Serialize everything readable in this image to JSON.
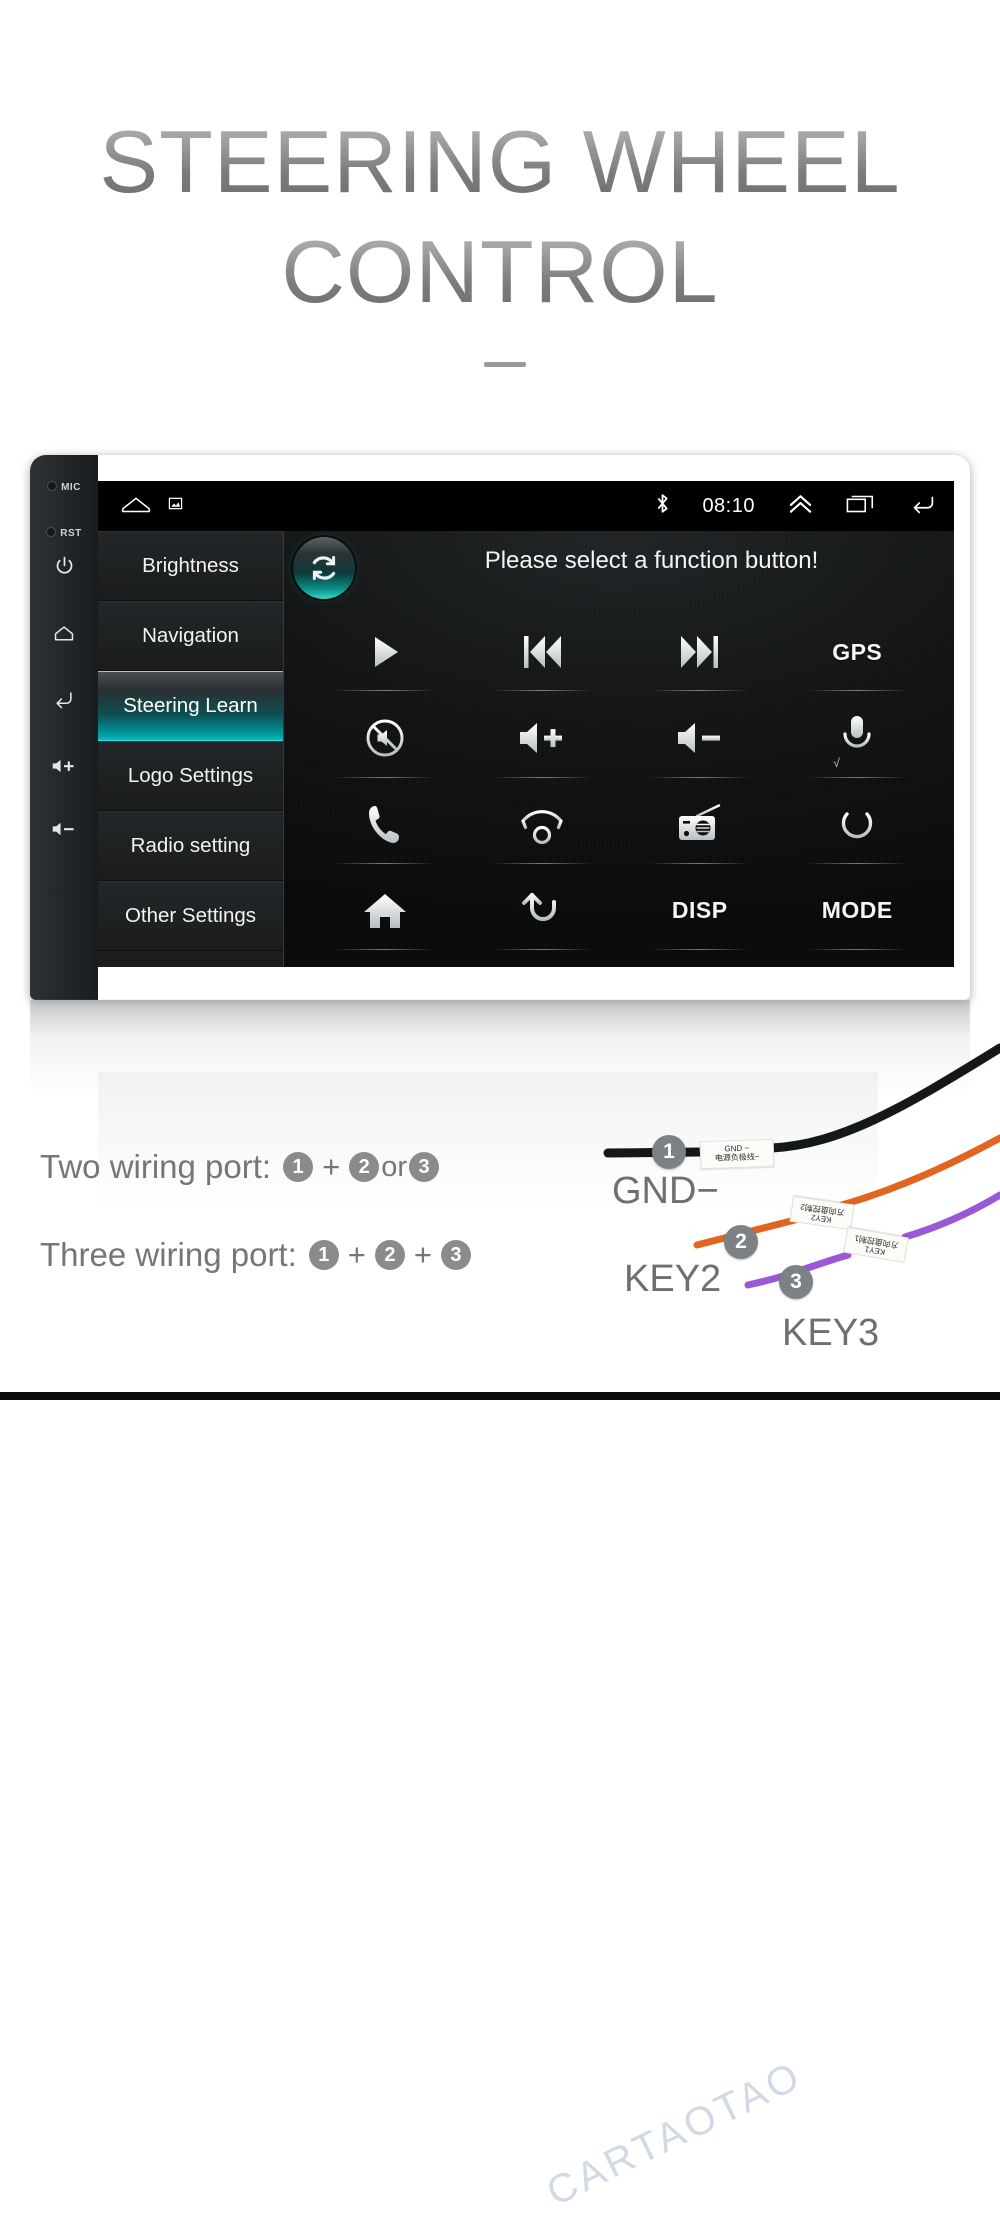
{
  "hero": {
    "line1": "STEERING WHEEL",
    "line2": "CONTROL"
  },
  "device": {
    "bezel": {
      "mic_label": "MIC",
      "rst_label": "RST",
      "power_icon": "power-icon",
      "home_icon": "home-icon",
      "back_icon": "back-icon",
      "volume_up_icon": "volume-up-icon",
      "volume_down_icon": "volume-down-icon"
    },
    "statusbar": {
      "home_icon": "home-outline-icon",
      "screenshot_icon": "screenshot-icon",
      "bluetooth_icon": "bluetooth-icon",
      "time": "08:10",
      "chevron_up_icon": "chevron-up-icon",
      "recents_icon": "recents-icon",
      "back_icon": "back-arrow-icon"
    },
    "menu": {
      "items": [
        {
          "label": "Brightness",
          "active": false
        },
        {
          "label": "Navigation",
          "active": false
        },
        {
          "label": "Steering Learn",
          "active": true
        },
        {
          "label": "Logo Settings",
          "active": false
        },
        {
          "label": "Radio setting",
          "active": false
        },
        {
          "label": "Other Settings",
          "active": false
        }
      ]
    },
    "panel": {
      "sync_icon": "sync-refresh-icon",
      "title": "Please select a function button!",
      "buttons": [
        {
          "name": "play-button",
          "icon": "play-icon",
          "text": ""
        },
        {
          "name": "previous-button",
          "icon": "previous-icon",
          "text": ""
        },
        {
          "name": "next-button",
          "icon": "next-icon",
          "text": ""
        },
        {
          "name": "gps-button",
          "icon": "text",
          "text": "GPS"
        },
        {
          "name": "mute-button",
          "icon": "mute-icon",
          "text": ""
        },
        {
          "name": "volume-up-button",
          "icon": "volume-up-icon",
          "text": ""
        },
        {
          "name": "volume-down-button",
          "icon": "volume-down-icon",
          "text": ""
        },
        {
          "name": "voice-button",
          "icon": "microphone-icon",
          "text": ""
        },
        {
          "name": "call-answer-button",
          "icon": "phone-icon",
          "text": ""
        },
        {
          "name": "call-end-button",
          "icon": "phone-hangup-icon",
          "text": ""
        },
        {
          "name": "radio-button",
          "icon": "radio-icon",
          "text": ""
        },
        {
          "name": "power-button",
          "icon": "power-icon",
          "text": ""
        },
        {
          "name": "home-button",
          "icon": "house-icon",
          "text": ""
        },
        {
          "name": "back-button",
          "icon": "back-arrow-icon",
          "text": ""
        },
        {
          "name": "disp-button",
          "icon": "text",
          "text": "DISP"
        },
        {
          "name": "mode-button",
          "icon": "text",
          "text": "MODE"
        }
      ],
      "mic_check_mark": "√"
    }
  },
  "wiring": {
    "two_port": {
      "label": "Two wiring port:",
      "a": "1",
      "op1": "+",
      "b": "2",
      "op2": "or",
      "c": "3"
    },
    "three_port": {
      "label": "Three wiring port:",
      "a": "1",
      "op1": "+",
      "b": "2",
      "op2": "+",
      "c": "3"
    }
  },
  "harness": {
    "watermark": "CARTAOTAO",
    "wires": [
      {
        "marker": "1",
        "name": "GND−",
        "color": "#15181a",
        "tag_line1": "GND −",
        "tag_line2": "电源负极线−"
      },
      {
        "marker": "2",
        "name": "KEY2",
        "color": "#e2651f",
        "tag_line1": "KEY2",
        "tag_line2": "方向盘控制2"
      },
      {
        "marker": "3",
        "name": "KEY3",
        "color": "#9a57d6",
        "tag_line1": "KEY1",
        "tag_line2": "方向盘控制1"
      }
    ]
  },
  "colors": {
    "accent_teal": "#12b9bd",
    "badge_gray": "#8b8b8b",
    "text_gray": "#767676"
  }
}
